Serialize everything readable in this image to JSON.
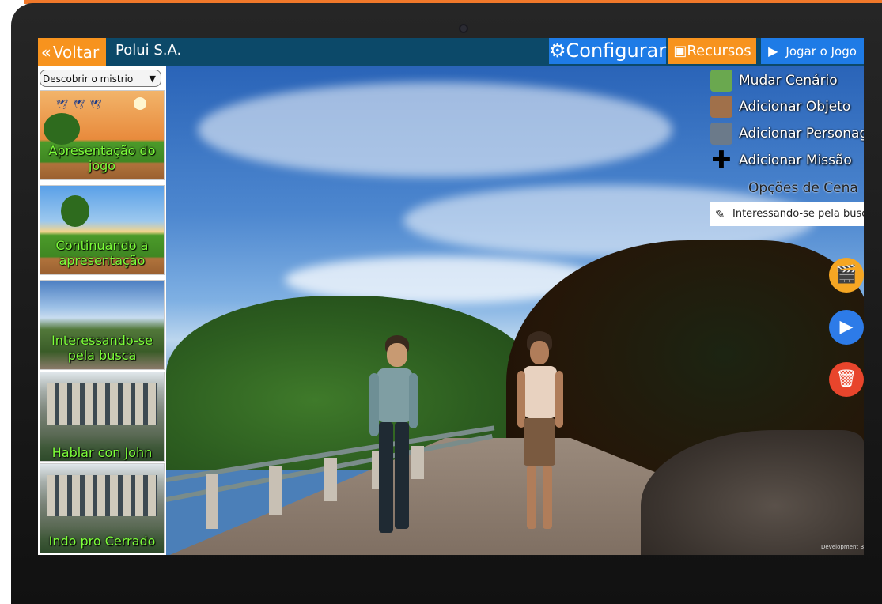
{
  "colors": {
    "accent_orange": "#f7931e",
    "accent_blue": "#1e7be6",
    "topbar_bg": "#0c4969",
    "scene_label_green": "#7dff3a",
    "fab_orange": "#f5a623",
    "fab_blue": "#2d7be8",
    "fab_red": "#e8452c"
  },
  "topbar": {
    "back_icon": "double-chevron-left-icon",
    "back_label": "Voltar",
    "company": "Polui S.A.",
    "configure_icon": "gear-icon",
    "configure_label": "Configurar",
    "resources_icon": "image-icon",
    "resources_label": "Recursos",
    "play_icon": "play-icon",
    "play_label": "Jogar o Jogo"
  },
  "sidebar": {
    "mission_select": "Descobrir o mistrio",
    "scenes": [
      {
        "label": "Apresentação do jogo"
      },
      {
        "label": "Continuando a apresentação"
      },
      {
        "label": "Interessando-se pela busca"
      },
      {
        "label": "Hablar con John"
      },
      {
        "label": "Indo pro Cerrado"
      }
    ]
  },
  "panel": {
    "items": [
      {
        "label": "Mudar Cenário",
        "icon": "landscape-icon"
      },
      {
        "label": "Adicionar Objeto",
        "icon": "box-icon"
      },
      {
        "label": "Adicionar Personagem",
        "icon": "person-icon"
      },
      {
        "label": "Adicionar Missão",
        "icon": "plus-icon"
      }
    ],
    "options_title": "Opções de Cena",
    "dialog_text": "Interessando-se pela busca"
  },
  "fabs": [
    {
      "icon": "clapperboard-icon"
    },
    {
      "icon": "play-icon"
    },
    {
      "icon": "trash-icon"
    }
  ],
  "watermark": "Development Build"
}
